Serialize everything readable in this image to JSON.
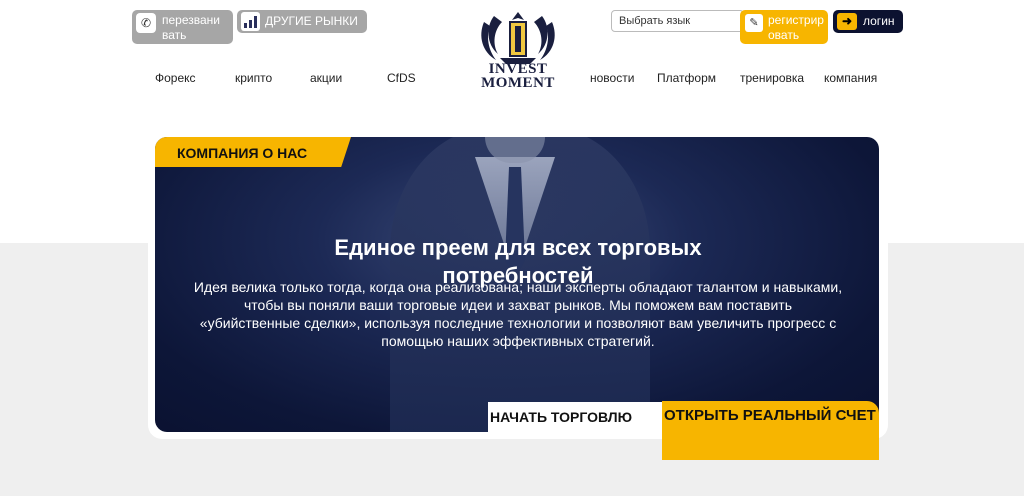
{
  "header": {
    "call_button": "перезвани вать",
    "markets_button": "ДРУГИЕ РЫНКИ",
    "logo": {
      "line1": "INVEST",
      "line2": "MOMENT"
    },
    "language_select": "Выбрать язык",
    "register_button": "регистрир овать",
    "login_button": "логин"
  },
  "nav": {
    "items": [
      "Форекс",
      "крипто",
      "акции",
      "CfDS",
      "новости",
      "Платформ",
      "тренировка",
      "компания"
    ]
  },
  "hero": {
    "tab": "КОМПАНИЯ О НАС",
    "title": "Единое преем для всех торговых потребностей",
    "text": "Идея велика только тогда, когда она реализована; наши эксперты обладают талантом и навыками, чтобы вы поняли ваши торговые идеи и захват рынков. Мы поможем вам поставить «убийственные сделки», используя последние технологии и позволяют вам увеличить прогресс с помощью наших эффективных стратегий.",
    "start_button": "НАЧАТЬ ТОРГОВЛЮ",
    "open_button": "ОТКРЫТЬ РЕАЛЬНЫЙ СЧЕТ"
  },
  "colors": {
    "accent": "#f7b500",
    "dark": "#0c1230",
    "grey_button": "#a6a6a6"
  }
}
